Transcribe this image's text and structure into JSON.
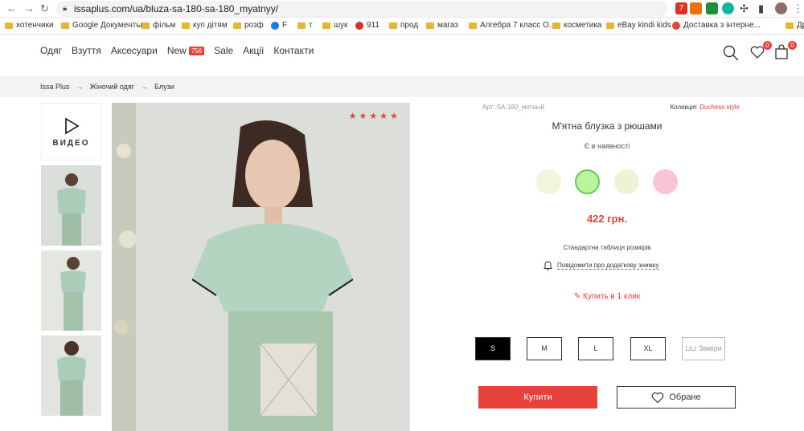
{
  "browser": {
    "url": "issaplus.com/ua/bluza-sa-180-sa-180_myatnyy/",
    "bookmarks": [
      "хотенчики",
      "Google Документы",
      "фільм",
      "куп дітям",
      "розф",
      "F",
      "т",
      "шук",
      "911",
      "прод",
      "магаз",
      "Алгебра 7 класс О...",
      "косметика",
      "eBay kindi kids",
      "Доставка з інтерне...",
      "Дру"
    ],
    "ext_badge": "7"
  },
  "header": {
    "menu": [
      "Одяг",
      "Взуття",
      "Аксесуари",
      "New",
      "Sale",
      "Акції",
      "Контакти"
    ],
    "new_count": "756",
    "wishlist_count": "0",
    "cart_count": "0"
  },
  "breadcrumb": [
    "Issa Plus",
    "Жіночий одяг",
    "Блузи"
  ],
  "gallery": {
    "video_label": "ВИДЕО",
    "stars": "★★★★★"
  },
  "product": {
    "article": "Арт: SA-180_мятный",
    "collection_label": "Колекція:",
    "collection_value": "Duchess style",
    "title": "М'ятна блузка з рюшами",
    "stock": "Є в наявності",
    "colors": [
      "#f3f4dc",
      "#b9f59b",
      "#eef3d6",
      "#fbc4d6"
    ],
    "price": "422 грн.",
    "size_table": "Стандартна таблиця розмірів",
    "notify": "Повідомити про додаткову знижку",
    "one_click": "Купить в 1 клик",
    "sizes": [
      "S",
      "M",
      "L",
      "XL"
    ],
    "measure": "Заміри",
    "buy": "Купити",
    "favorite": "Обране"
  }
}
